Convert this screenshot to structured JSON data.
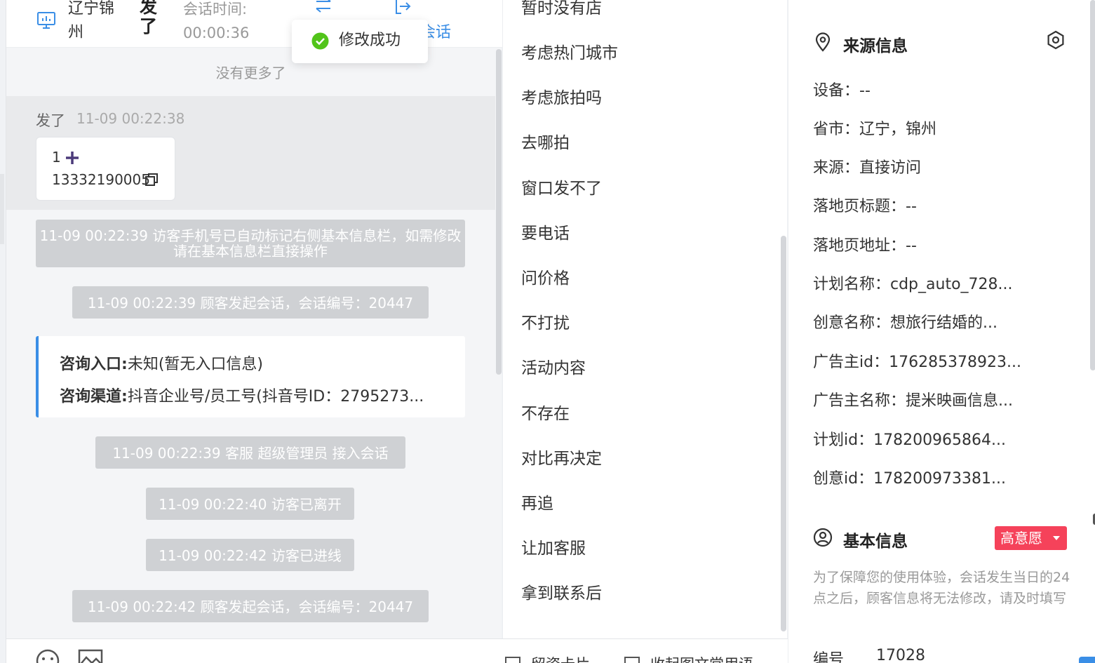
{
  "header": {
    "city": "辽宁锦州",
    "visitor_name": "发了",
    "time_label": "会话时间:",
    "time_value": "00:00:36",
    "end_session_label": "会话",
    "toast_text": "修改成功"
  },
  "chat": {
    "no_more": "没有更多了",
    "message": {
      "sender": "发了",
      "time": "11-09 00:22:38",
      "line1": "1",
      "line2": "13332190005"
    },
    "system_messages": [
      "11-09 00:22:39 访客手机号已自动标记右侧基本信息栏，如需修改请在基本信息栏直接操作",
      "11-09 00:22:39 顾客发起会话，会话编号：20447",
      "11-09 00:22:39 客服 超级管理员 接入会话",
      "11-09 00:22:40 访客已离开",
      "11-09 00:22:42 访客已进线",
      "11-09 00:22:42 顾客发起会话，会话编号：20447"
    ],
    "entry_info": {
      "entry_label": "咨询入口:",
      "entry_value": "未知(暂无入口信息)",
      "channel_label": "咨询渠道:",
      "channel_value": "抖音企业号/员工号(抖音号ID：2795273..."
    }
  },
  "footer": {
    "label1": "留资卡片",
    "label2": "收起图文常用语"
  },
  "phrases": [
    "暂时没有店",
    "考虑热门城市",
    "考虑旅拍吗",
    "去哪拍",
    "窗口发不了",
    "要电话",
    "问价格",
    "不打扰",
    "活动内容",
    "不存在",
    "对比再决定",
    "再追",
    "让加客服",
    "拿到联系后"
  ],
  "source_info": {
    "title": "来源信息",
    "fields": [
      "设备：--",
      "省市：辽宁，锦州",
      "来源：直接访问",
      "落地页标题：--",
      "落地页地址：--",
      "计划名称：cdp_auto_728...",
      "创意名称：想旅行结婚的...",
      "广告主id：176285378923...",
      "广告主名称：提米映画信息...",
      "计划id：178200965864...",
      "创意id：178200973381..."
    ]
  },
  "basic_info": {
    "title": "基本信息",
    "intent_badge": "高意愿",
    "notice": "为了保障您的使用体验，会话发生当日的24点之后，顾客信息将无法修改，请及时填写",
    "id_label": "编号",
    "id_value": "17028"
  },
  "colors": {
    "accent": "#3a8ee6",
    "success": "#52c41a",
    "badge": "#f5425a",
    "system_bg": "#cfd1d4"
  }
}
